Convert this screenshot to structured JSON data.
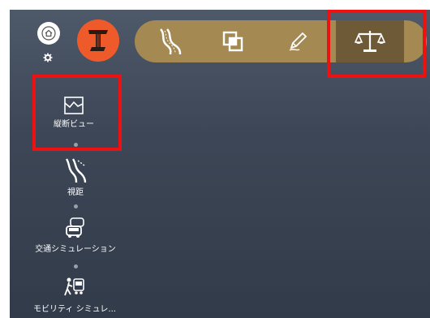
{
  "top_left": {
    "home_icon": "home-icon",
    "settings_icon": "gear-icon",
    "logo_letter": "I"
  },
  "toolbar": {
    "tools": [
      {
        "icon": "road-icon"
      },
      {
        "icon": "overlay-icon"
      },
      {
        "icon": "pencil-icon"
      },
      {
        "icon": "scales-icon",
        "active": true
      }
    ]
  },
  "sidebar": {
    "items": [
      {
        "label": "縦断ビュー",
        "icon": "profile-view-icon"
      },
      {
        "label": "視距",
        "icon": "sight-distance-icon"
      },
      {
        "label": "交通シミュレーション",
        "icon": "traffic-icon"
      },
      {
        "label": "モビリティ シミュレ...",
        "icon": "mobility-icon"
      }
    ]
  },
  "colors": {
    "accent": "#a48a52",
    "active_tool": "#6f5a37",
    "logo": "#ef5a2a",
    "highlight": "#ee1111"
  }
}
